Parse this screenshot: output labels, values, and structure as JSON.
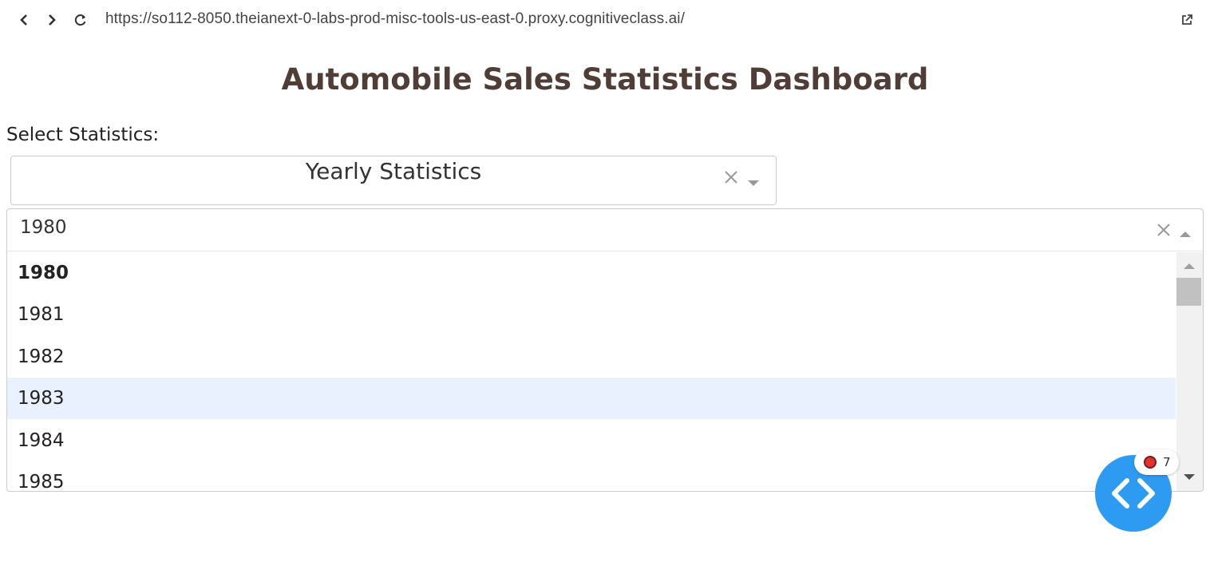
{
  "browser": {
    "url": "https://so112-8050.theianext-0-labs-prod-misc-tools-us-east-0.proxy.cognitiveclass.ai/"
  },
  "page": {
    "title": "Automobile Sales Statistics Dashboard",
    "select_label": "Select Statistics:"
  },
  "dropdown_statistics": {
    "value": "Yearly Statistics"
  },
  "dropdown_year": {
    "value": "1980",
    "options": [
      "1980",
      "1981",
      "1982",
      "1983",
      "1984",
      "1985"
    ],
    "selected": "1980",
    "focused": "1983"
  },
  "dev_tools": {
    "error_count": "7"
  },
  "colors": {
    "title": "#503D36",
    "focus_bg": "#E8F1FD",
    "fab": "#2E9BF3",
    "error_dot": "#E4322E"
  }
}
